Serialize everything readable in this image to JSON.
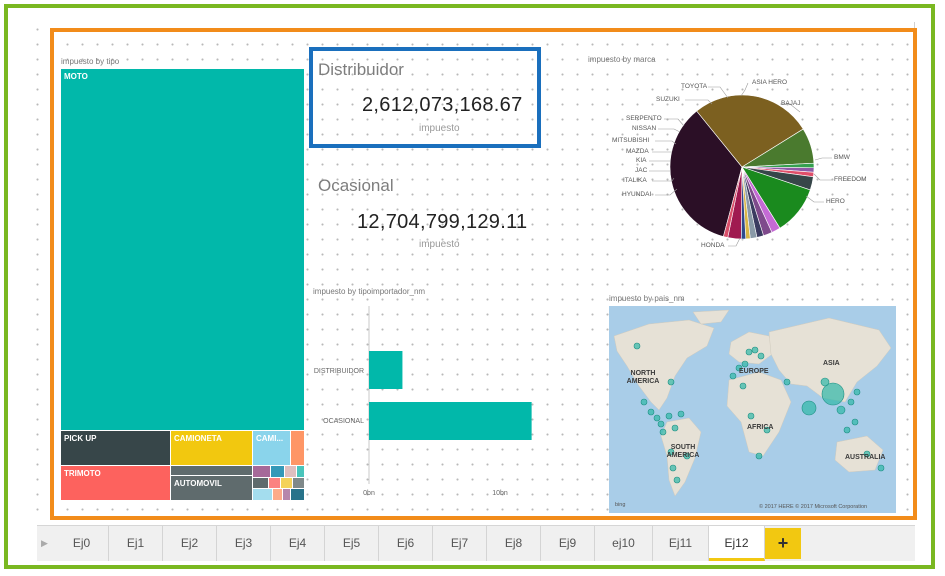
{
  "treemap": {
    "title": "impuesto by tipo",
    "tiles": [
      {
        "label": "MOTO",
        "color": "#01b8aa"
      },
      {
        "label": "PICK UP",
        "color": "#374649"
      },
      {
        "label": "CAMIONETA",
        "color": "#f2c80f"
      },
      {
        "label": "CAMI...",
        "color": "#8ad4eb"
      },
      {
        "label": "TRIMOTO",
        "color": "#fd625e"
      },
      {
        "label": "AUTOMOVIL",
        "color": "#5f6b6d"
      }
    ]
  },
  "cards": [
    {
      "title": "Distribuidor",
      "value": "2,612,073,168.67",
      "label": "impuesto"
    },
    {
      "title": "Ocasional",
      "value": "12,704,799,129.11",
      "label": "impuesto"
    }
  ],
  "pie": {
    "title": "impuesto by marca",
    "labels": [
      "TOYOTA",
      "ASIA HERO",
      "SUZUKI",
      "BAJAJ",
      "SERPENTO",
      "NISSAN",
      "MITSUBISHI",
      "MAZDA",
      "KIA",
      "BMW",
      "JAC",
      "ITALIKA",
      "FREEDOM",
      "HYUNDAI",
      "HERO",
      "HONDA"
    ]
  },
  "bar": {
    "title": "impuesto by tipoimportador_nm",
    "categories": [
      "DISTRIBUIDOR",
      "OCASIONAL"
    ],
    "ticks": [
      "0bn",
      "10bn"
    ]
  },
  "map": {
    "title": "impuesto by pais_nm",
    "labels": [
      "NORTH AMERICA",
      "EUROPE",
      "ASIA",
      "AFRICA",
      "SOUTH AMERICA",
      "AUSTRALIA"
    ],
    "bing": "bing",
    "copyright": "© 2017 HERE   © 2017 Microsoft Corporation"
  },
  "chart_data": [
    {
      "type": "bar",
      "title": "impuesto by tipoimportador_nm",
      "categories": [
        "DISTRIBUIDOR",
        "OCASIONAL"
      ],
      "values": [
        2.612073168,
        12.704799129
      ],
      "xlabel": "",
      "ylabel": "",
      "xlim": [
        0,
        14
      ]
    },
    {
      "type": "pie",
      "title": "impuesto by marca",
      "categories": [
        "HONDA",
        "BAJAJ",
        "FREEDOM",
        "HERO",
        "BMW",
        "ASIA HERO",
        "TOYOTA",
        "SUZUKI",
        "SERPENTO",
        "NISSAN",
        "MITSUBISHI",
        "MAZDA",
        "KIA",
        "JAC",
        "ITALIKA",
        "HYUNDAI"
      ],
      "values": [
        35,
        27,
        8,
        1,
        1,
        1,
        3,
        11,
        2,
        2,
        1.5,
        1.5,
        1,
        1,
        3,
        1
      ],
      "colors": [
        "#2b0f26",
        "#7c6020",
        "#4a7a2e",
        "#35a04f",
        "#8e5aa7",
        "#e04f6a",
        "#374649",
        "#1a8a1e",
        "#c46ad4",
        "#7f4a8c",
        "#3b3b60",
        "#8a9aa8",
        "#d9b646",
        "#2e4a8c",
        "#a01a50",
        "#d94f6a"
      ]
    }
  ],
  "tabs": [
    "Ej0",
    "Ej1",
    "Ej2",
    "Ej3",
    "Ej4",
    "Ej5",
    "Ej6",
    "Ej7",
    "Ej8",
    "Ej9",
    "ej10",
    "Ej11",
    "Ej12"
  ],
  "active_tab": "Ej12",
  "add_tab_label": "+",
  "colors": {
    "accent_green": "#7ab821",
    "accent_orange": "#f28c1a",
    "accent_blue": "#1a6fbd",
    "teal": "#01b8aa"
  }
}
